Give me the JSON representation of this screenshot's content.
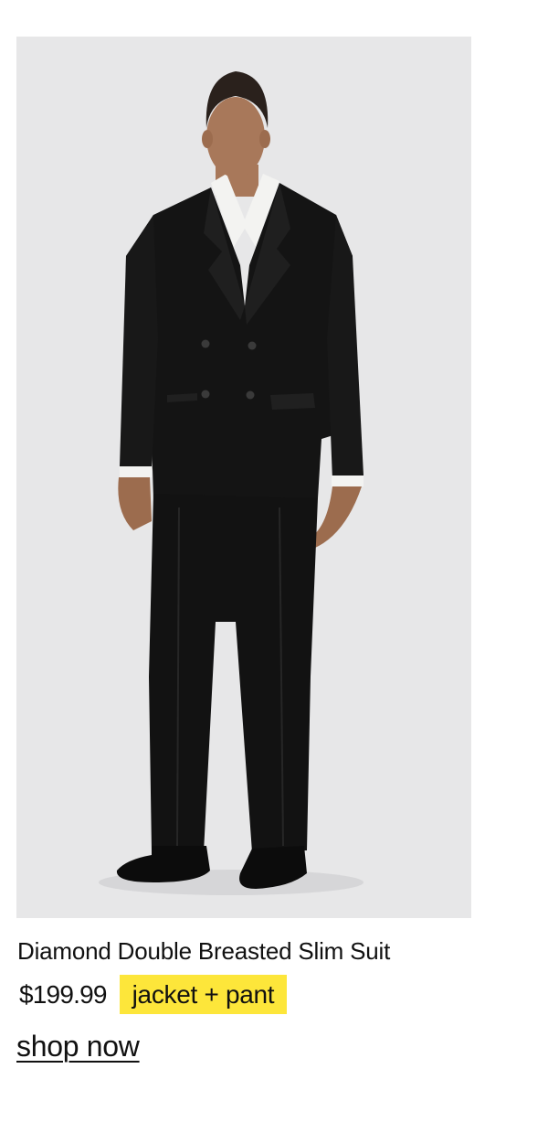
{
  "product": {
    "title": "Diamond Double Breasted Slim Suit",
    "price": "$199.99",
    "badge": "jacket + pant",
    "cta_label": "shop now",
    "image_alt": "Man wearing black double breasted suit with white shirt and black dress shoes"
  },
  "colors": {
    "image_background": "#e7e7e8",
    "badge_background": "#fde63a",
    "text": "#111111",
    "suit": "#141414",
    "shirt": "#f3f3f1"
  }
}
